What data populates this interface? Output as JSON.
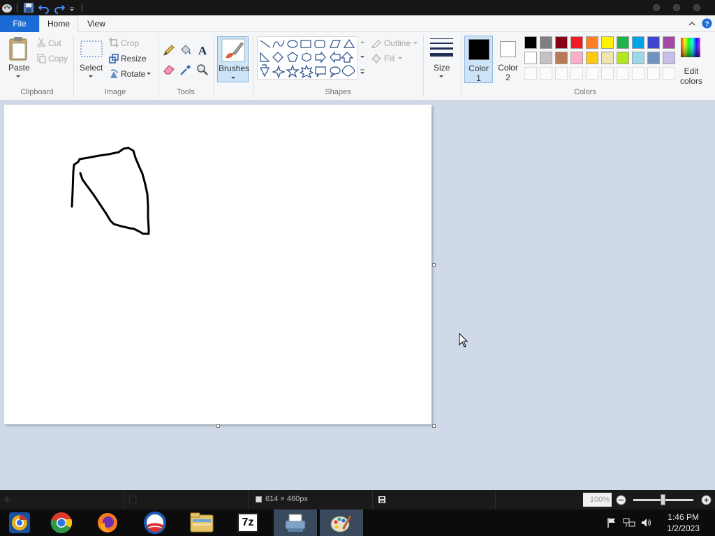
{
  "menu": {
    "file": "File",
    "home": "Home",
    "view": "View"
  },
  "ribbon": {
    "clipboard": {
      "paste": "Paste",
      "cut": "Cut",
      "copy": "Copy",
      "label": "Clipboard"
    },
    "image": {
      "select": "Select",
      "crop": "Crop",
      "resize": "Resize",
      "rotate": "Rotate",
      "label": "Image"
    },
    "tools": {
      "label": "Tools"
    },
    "brushes": "Brushes",
    "shapes": {
      "outline": "Outline",
      "fill": "Fill",
      "label": "Shapes"
    },
    "size": "Size",
    "color1": {
      "line1": "Color",
      "line2": "1"
    },
    "color2": {
      "line1": "Color",
      "line2": "2"
    },
    "colors_label": "Colors",
    "edit_colors": {
      "line1": "Edit",
      "line2": "colors"
    }
  },
  "colors": {
    "color1": "#000000",
    "color2": "#ffffff",
    "palette_row1": [
      "#000000",
      "#7f7f7f",
      "#880015",
      "#ed1c24",
      "#ff7f27",
      "#fff200",
      "#22b14c",
      "#00a2e8",
      "#3f48cc",
      "#a349a4"
    ],
    "palette_row2": [
      "#ffffff",
      "#c3c3c3",
      "#b97a57",
      "#ffaec9",
      "#ffc90e",
      "#efe4b0",
      "#b5e61d",
      "#99d9ea",
      "#7092be",
      "#c8bfe7"
    ],
    "accent": "#1b6bd6"
  },
  "status": {
    "canvas_size": "614 × 460px",
    "zoom": "100%"
  },
  "taskbar": {
    "apps": [
      "chromium-icon",
      "chrome-icon",
      "firefox-icon",
      "obama-logo-icon",
      "file-manager-icon",
      "7zip-icon",
      "printer-scanner-icon",
      "paint-icon"
    ],
    "label_7z": "7z",
    "time": "1:46 PM",
    "date": "1/2/2023"
  }
}
